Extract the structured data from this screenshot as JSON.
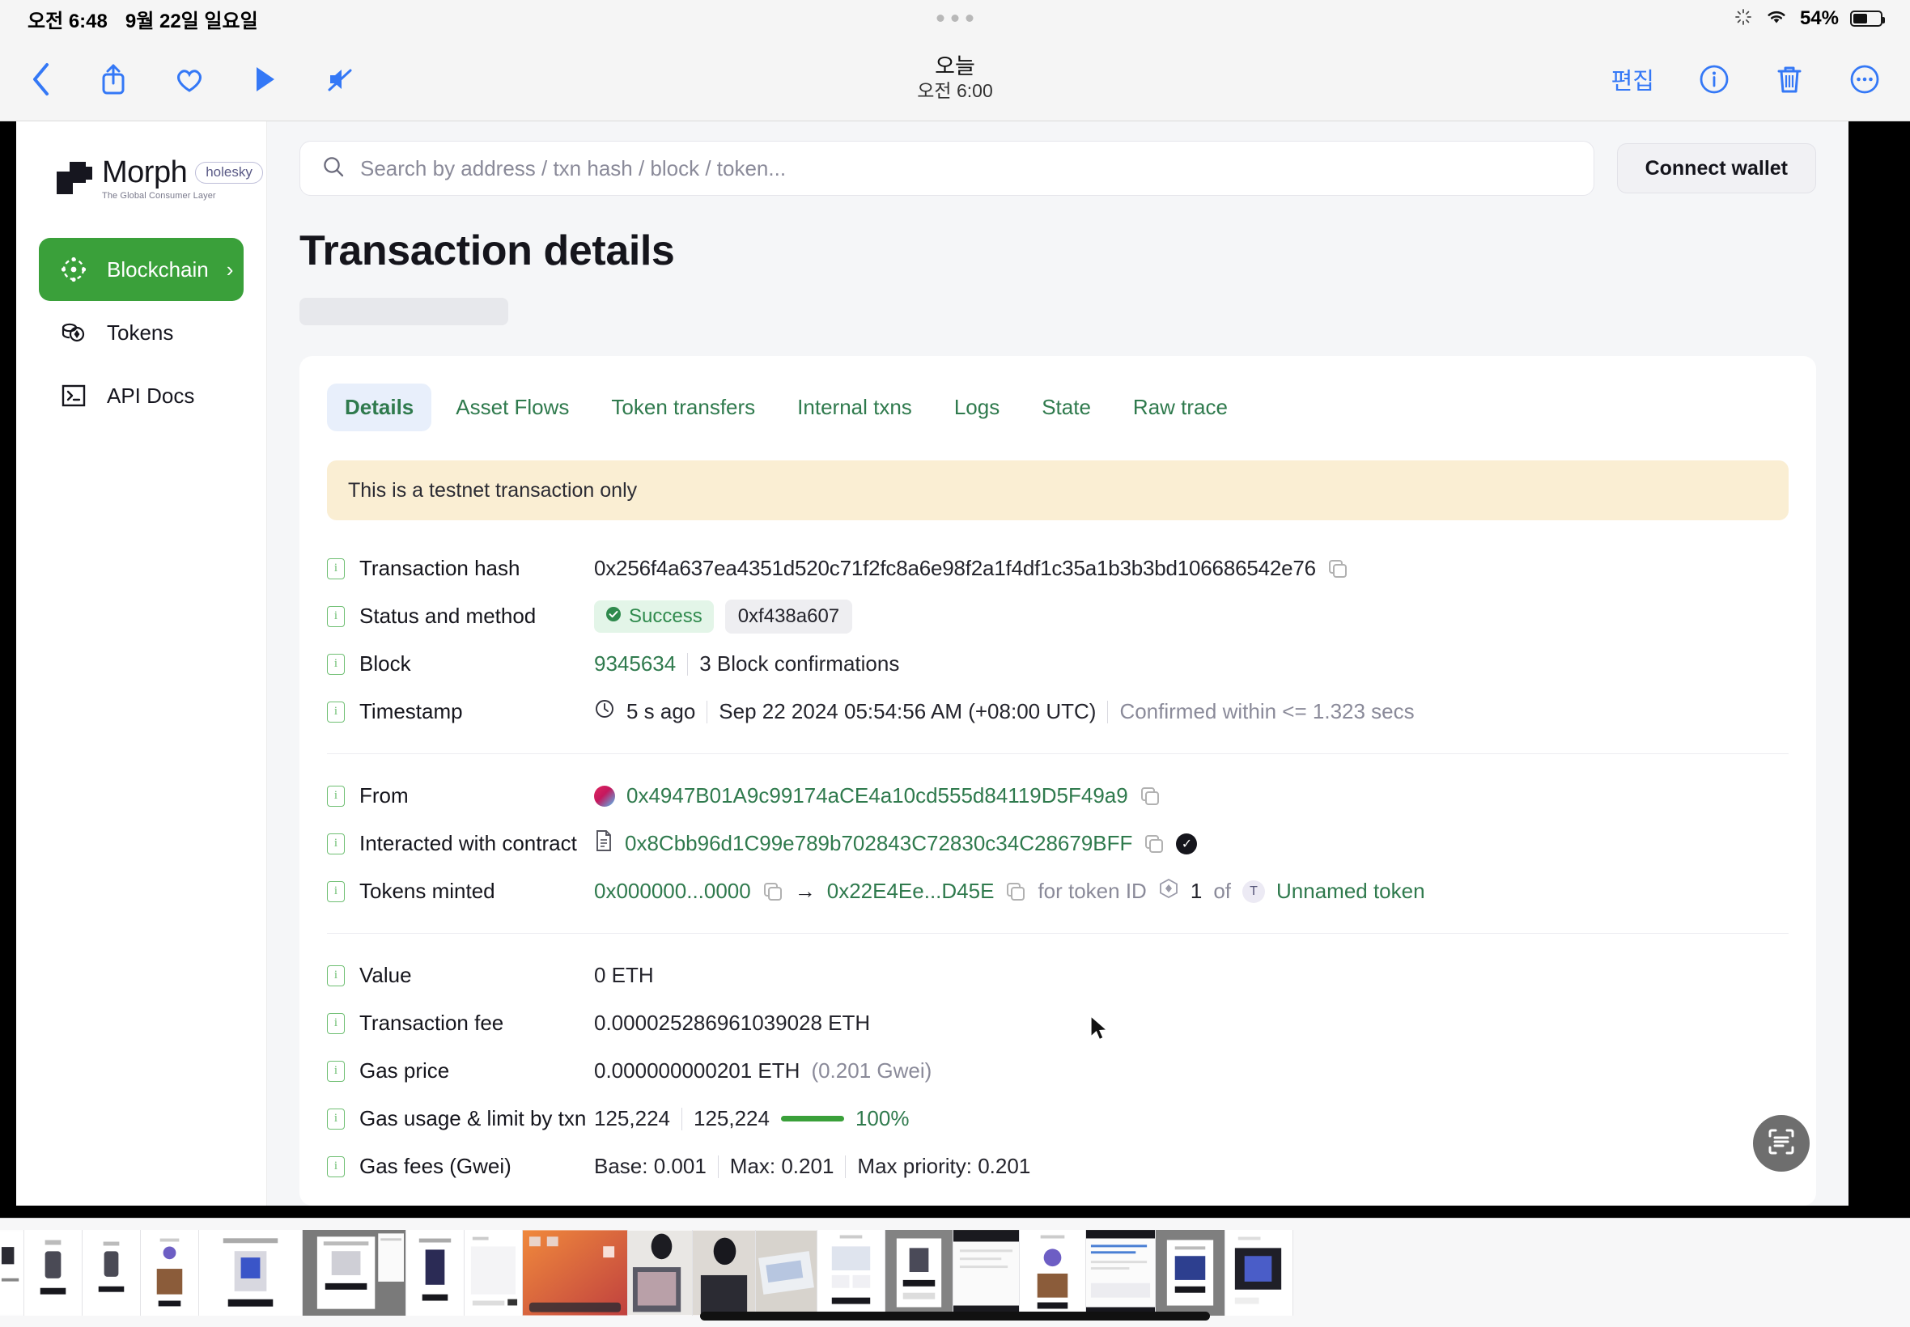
{
  "status_bar": {
    "time": "오전 6:48",
    "date": "9월 22일 일요일",
    "battery_pct": "54%",
    "wifi_icon": "wifi-icon",
    "spinner_icon": "activity-spinner-icon",
    "battery_icon": "battery-icon"
  },
  "toolbar": {
    "back_icon": "back-chevron-icon",
    "share_icon": "share-icon",
    "favorite_icon": "heart-icon",
    "play_icon": "play-icon",
    "mute_icon": "speaker-mute-icon",
    "edit_label": "편집",
    "info_icon": "info-circle-icon",
    "delete_icon": "trash-icon",
    "more_icon": "more-ellipsis-circle-icon",
    "title": "오늘",
    "subtitle": "오전 6:00"
  },
  "sidebar": {
    "logo_name": "Morph",
    "logo_badge": "holesky",
    "logo_tagline": "The Global Consumer Layer",
    "items": [
      {
        "label": "Blockchain",
        "icon": "blockchain-icon",
        "active": true,
        "chevron": "›"
      },
      {
        "label": "Tokens",
        "icon": "tokens-coins-icon",
        "active": false
      },
      {
        "label": "API Docs",
        "icon": "terminal-icon",
        "active": false
      }
    ]
  },
  "search": {
    "placeholder": "Search by address / txn hash / block / token...",
    "value": "",
    "icon": "search-icon"
  },
  "header": {
    "connect_wallet": "Connect wallet",
    "page_title": "Transaction details"
  },
  "tabs": [
    {
      "label": "Details",
      "active": true
    },
    {
      "label": "Asset Flows",
      "active": false
    },
    {
      "label": "Token transfers",
      "active": false
    },
    {
      "label": "Internal txns",
      "active": false
    },
    {
      "label": "Logs",
      "active": false
    },
    {
      "label": "State",
      "active": false
    },
    {
      "label": "Raw trace",
      "active": false
    }
  ],
  "notice": "This is a testnet transaction only",
  "details": {
    "transaction_hash": {
      "label": "Transaction hash",
      "value": "0x256f4a637ea4351d520c71f2fc8a6e98f2a1f4df1c35a1b3b3bd106686542e76",
      "copy_icon": "copy-icon"
    },
    "status_and_method": {
      "label": "Status and method",
      "status": "Success",
      "status_icon": "check-circle-icon",
      "method": "0xf438a607"
    },
    "block": {
      "label": "Block",
      "number": "9345634",
      "confirmations": "3 Block confirmations"
    },
    "timestamp": {
      "label": "Timestamp",
      "clock_icon": "clock-icon",
      "relative": "5 s ago",
      "absolute": "Sep 22 2024 05:54:56 AM (+08:00 UTC)",
      "confirmed": "Confirmed within <= 1.323 secs"
    },
    "from": {
      "label": "From",
      "avatar_icon": "address-avatar-icon",
      "address": "0x4947B01A9c99174aCE4a10cd555d84119D5F49a9",
      "copy_icon": "copy-icon"
    },
    "interacted_with_contract": {
      "label": "Interacted with contract",
      "doc_icon": "contract-document-icon",
      "address": "0x8Cbb96d1C99e789b702843C72830c34C28679BFF",
      "copy_icon": "copy-icon",
      "verified_icon": "verified-check-icon"
    },
    "tokens_minted": {
      "label": "Tokens minted",
      "from_address": "0x000000...0000",
      "arrow": "→",
      "to_address": "0x22E4Ee...D45E",
      "for_token_id_text": "for token ID",
      "token_icon": "nft-token-icon",
      "token_id": "1",
      "of_text": "of",
      "token_badge": "T",
      "token_name": "Unnamed token",
      "copy_icon": "copy-icon"
    },
    "value": {
      "label": "Value",
      "value": "0 ETH"
    },
    "transaction_fee": {
      "label": "Transaction fee",
      "value": "0.000025286961039028 ETH"
    },
    "gas_price": {
      "label": "Gas price",
      "value": "0.000000000201 ETH",
      "gwei": "(0.201 Gwei)"
    },
    "gas_usage": {
      "label": "Gas usage & limit by txn",
      "used": "125,224",
      "limit": "125,224",
      "percent": "100%"
    },
    "gas_fees": {
      "label": "Gas fees (Gwei)",
      "base": "Base: 0.001",
      "max": "Max: 0.201",
      "max_priority": "Max priority: 0.201"
    }
  },
  "fab": {
    "icon": "text-scan-icon"
  },
  "colors": {
    "accent_green": "#3aa03a",
    "link_green": "#2f7a4d",
    "ios_blue": "#3478f6",
    "notice_bg": "#faeed3",
    "tab_active_bg": "#e8effb"
  }
}
